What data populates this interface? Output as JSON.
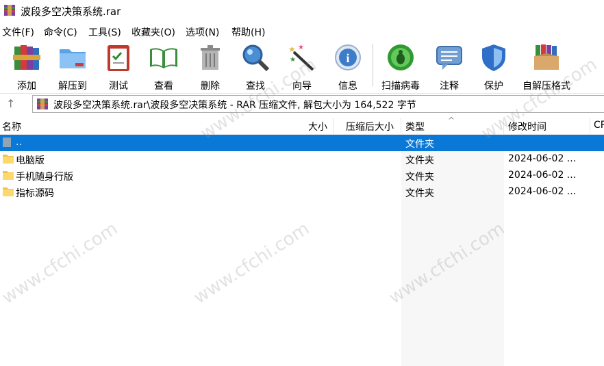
{
  "window": {
    "title": "波段多空决策系统.rar"
  },
  "menu": [
    "文件(F)",
    "命令(C)",
    "工具(S)",
    "收藏夹(O)",
    "选项(N)",
    "帮助(H)"
  ],
  "toolbar": [
    "添加",
    "解压到",
    "测试",
    "查看",
    "删除",
    "查找",
    "向导",
    "信息",
    "扫描病毒",
    "注释",
    "保护",
    "自解压格式"
  ],
  "address": {
    "path": "波段多空决策系统.rar\\波段多空决策系统 - RAR 压缩文件, 解包大小为 164,522 字节"
  },
  "columns": {
    "name": "名称",
    "size": "大小",
    "packed": "压缩后大小",
    "type": "类型",
    "modified": "修改时间",
    "crc": "CR"
  },
  "rows": [
    {
      "name": "..",
      "type": "文件夹",
      "modified": ""
    },
    {
      "name": "电脑版",
      "type": "文件夹",
      "modified": "2024-06-02 ..."
    },
    {
      "name": "手机随身行版",
      "type": "文件夹",
      "modified": "2024-06-02 ..."
    },
    {
      "name": "指标源码",
      "type": "文件夹",
      "modified": "2024-06-02 ..."
    }
  ],
  "watermark": "www.cfchi.com",
  "colors": {
    "selection": "#0a78d7",
    "folder": "#f3c24a"
  }
}
